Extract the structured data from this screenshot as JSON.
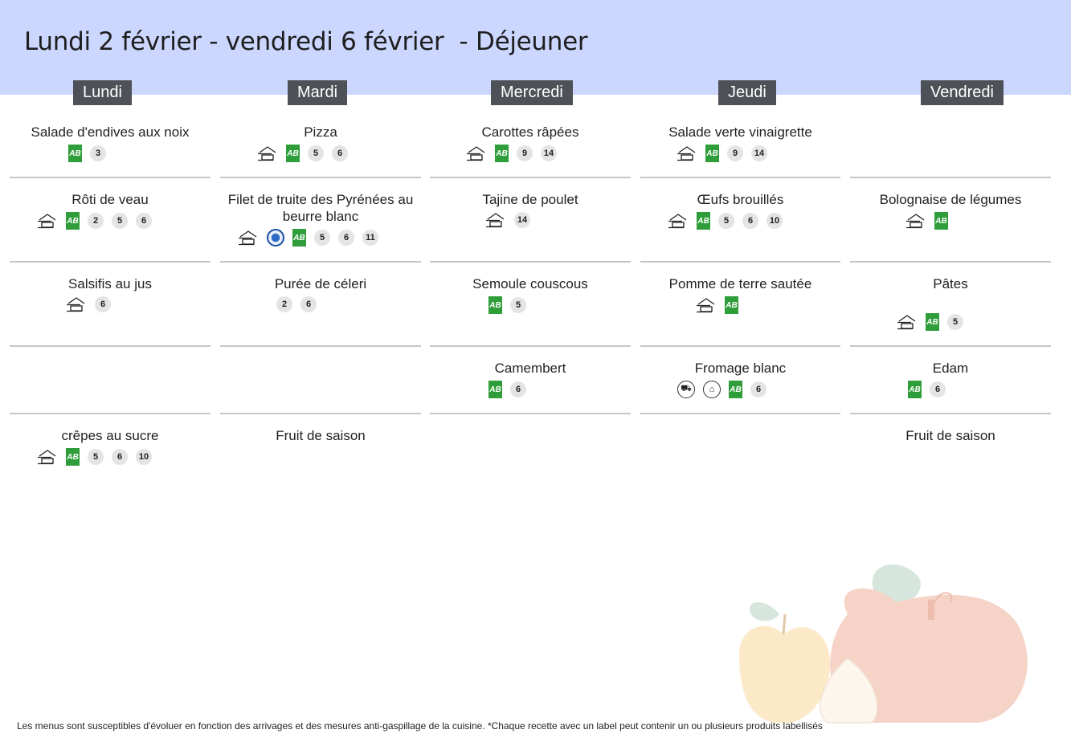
{
  "title": "Lundi 2 février - vendredi 6 février  - Déjeuner",
  "days": [
    "Lundi",
    "Mardi",
    "Mercredi",
    "Jeudi",
    "Vendredi"
  ],
  "dishes": {
    "lundi": [
      "Salade d'endives aux noix",
      "Rôti de veau",
      "Salsifis au jus",
      "crêpes au sucre"
    ],
    "mardi": [
      "Pizza",
      "Filet de truite des Pyrénées au beurre blanc",
      "Purée de céleri",
      "Fruit de saison"
    ],
    "mercredi": [
      "Carottes râpées",
      "Tajine de poulet",
      "Semoule couscous",
      "Camembert"
    ],
    "jeudi": [
      "Salade verte vinaigrette",
      "Œufs brouillés",
      "Pomme de terre sautée",
      "Fromage blanc"
    ],
    "vendredi": [
      "Bolognaise de légumes",
      "Pâtes",
      "Edam",
      "Fruit de saison"
    ]
  },
  "allergens": {
    "lundi": [
      [
        "3"
      ],
      [
        "2",
        "5",
        "6"
      ],
      [
        "6"
      ],
      [
        "5",
        "6",
        "10"
      ]
    ],
    "mardi": [
      [
        "5",
        "6"
      ],
      [
        "5",
        "6",
        "11"
      ],
      [
        "2",
        "6"
      ],
      []
    ],
    "mercredi": [
      [
        "9",
        "14"
      ],
      [
        "14"
      ],
      [
        "5"
      ],
      [
        "6"
      ]
    ],
    "jeudi": [
      [
        "9",
        "14"
      ],
      [
        "5",
        "6",
        "10"
      ],
      [],
      [
        "6"
      ]
    ],
    "vendredi": [
      [],
      [
        "5"
      ],
      [
        "6"
      ],
      []
    ]
  },
  "labels": {
    "organic": "AB",
    "icon_names": [
      "homemade-icon",
      "organic-label-icon",
      "quality-label-icon",
      "tractor-icon",
      "local-origin-icon"
    ]
  },
  "colors": {
    "header_band": "#ccd7ff",
    "day_header": "#4e5157",
    "organic_green": "#2f9e3a",
    "allergen_bg": "#e4e4e4",
    "separator": "#c3c7cc"
  },
  "footer": "Les menus sont susceptibles d'évoluer en fonction des arrivages et des mesures anti-gaspillage de la cuisine. *Chaque recette avec un label peut contenir un ou plusieurs produits labellisés"
}
